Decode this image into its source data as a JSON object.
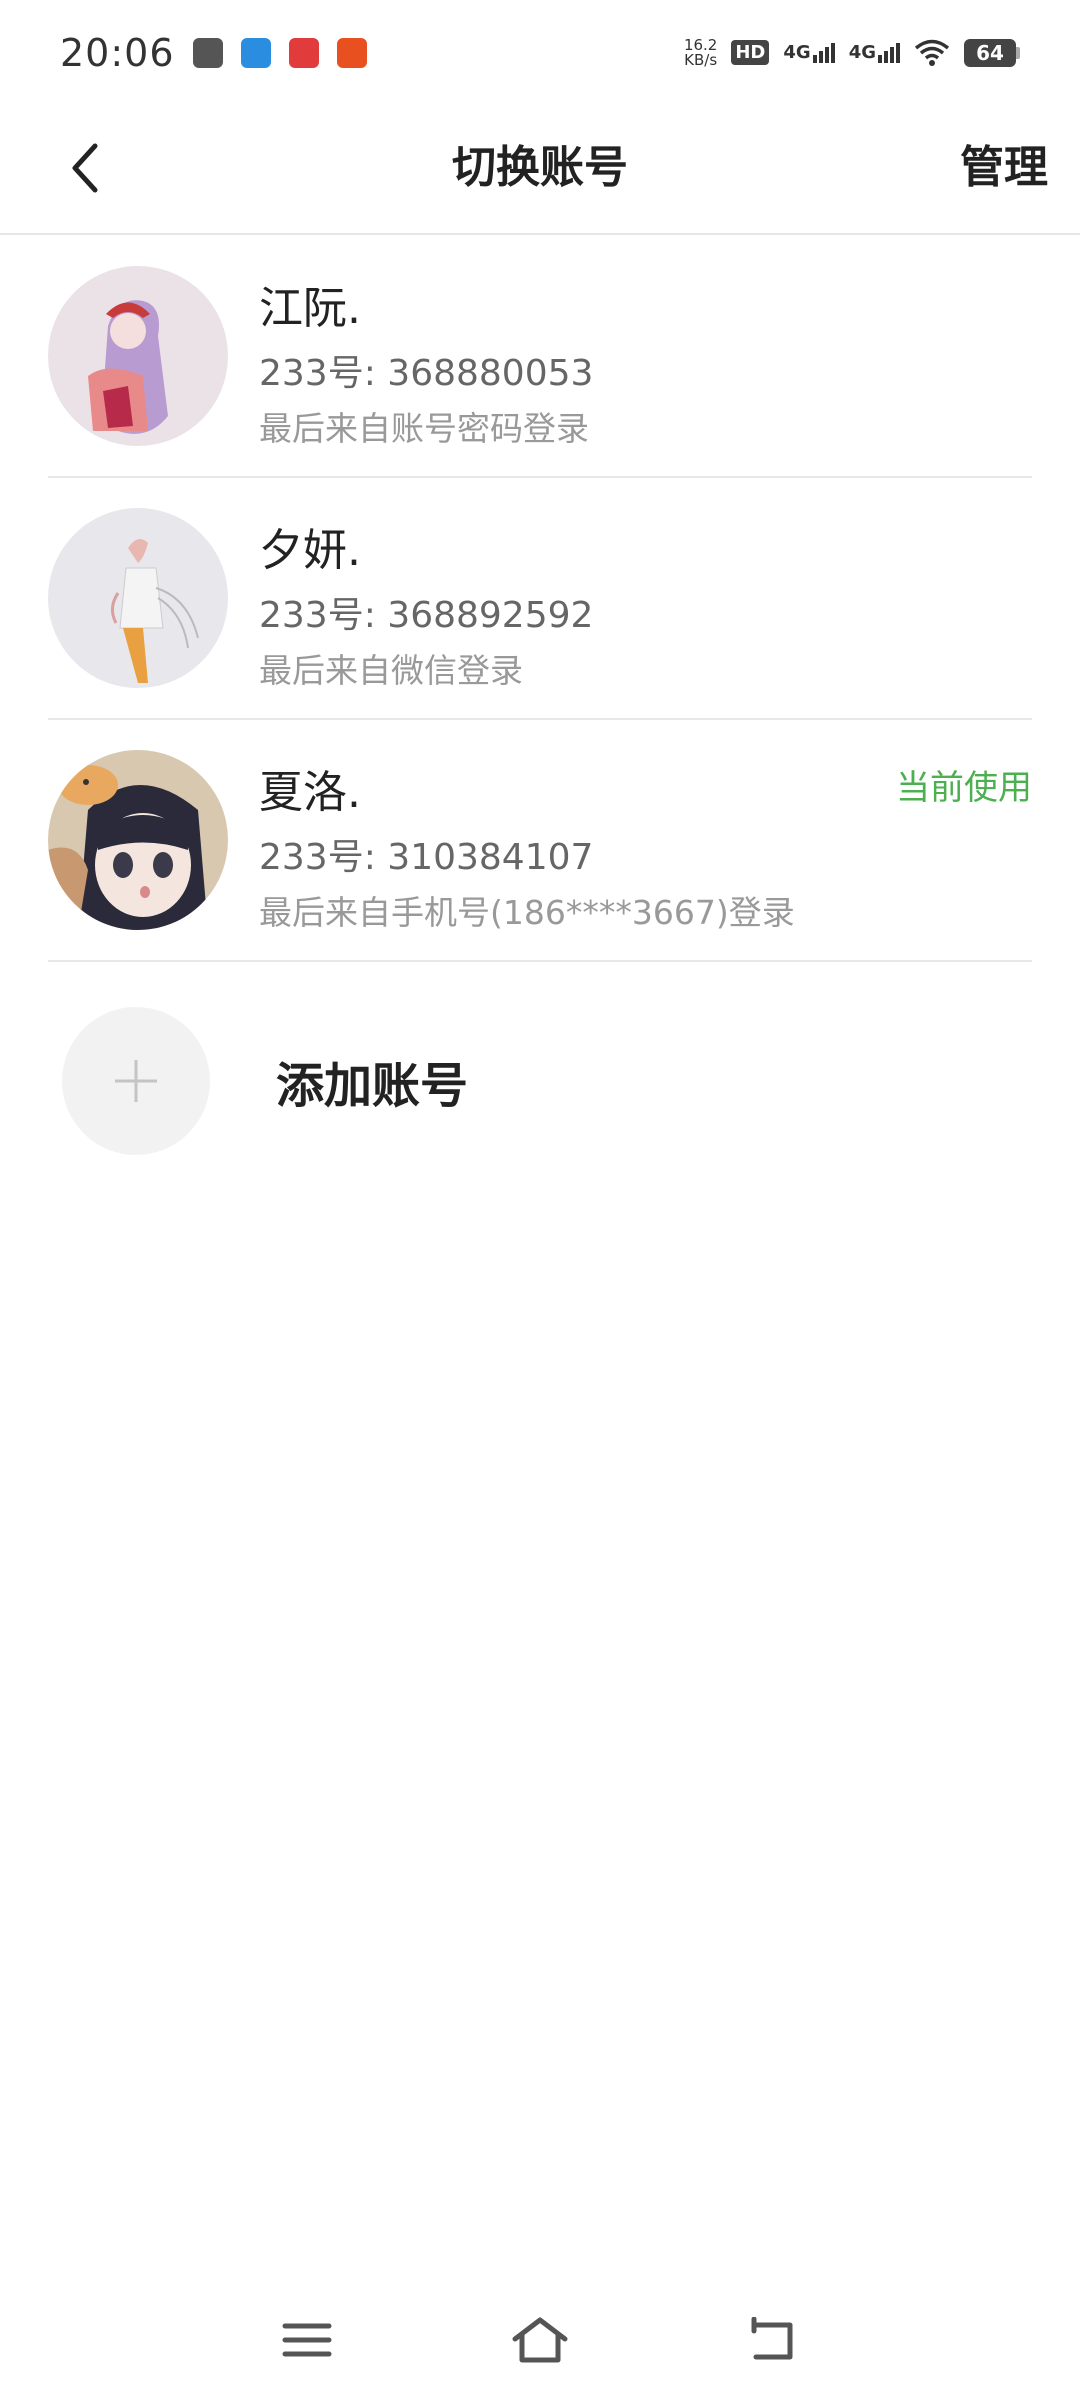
{
  "status_bar": {
    "time": "20:06",
    "net_speed_value": "16.2",
    "net_speed_unit": "KB/s",
    "hd_label": "HD",
    "network_1": "4G",
    "network_2": "4G",
    "battery": "64",
    "app_icons": [
      "tooltool-icon",
      "paper-plane-app-icon",
      "news-app-icon",
      "orange-app-icon"
    ],
    "app_colors": [
      "#555555",
      "#2a8de0",
      "#e23b3b",
      "#e8501f"
    ]
  },
  "header": {
    "title": "切换账号",
    "manage_label": "管理",
    "back_icon": "chevron-left-icon"
  },
  "accounts": [
    {
      "name": "江阮.",
      "id_text": "233号: 368880053",
      "login_text": "最后来自账号密码登录",
      "status": ""
    },
    {
      "name": "夕妍.",
      "id_text": "233号: 368892592",
      "login_text": "最后来自微信登录",
      "status": ""
    },
    {
      "name": "夏洛.",
      "id_text": "233号: 310384107",
      "login_text": "最后来自手机号(186****3667)登录",
      "status": "当前使用"
    }
  ],
  "add_account": {
    "label": "添加账号",
    "icon": "plus-icon"
  },
  "nav_bar": {
    "icons": [
      "menu-icon",
      "home-icon",
      "back-icon"
    ]
  },
  "colors": {
    "current_status": "#4caf50",
    "divider": "#e8e8e8",
    "add_bg": "#f2f2f2"
  }
}
